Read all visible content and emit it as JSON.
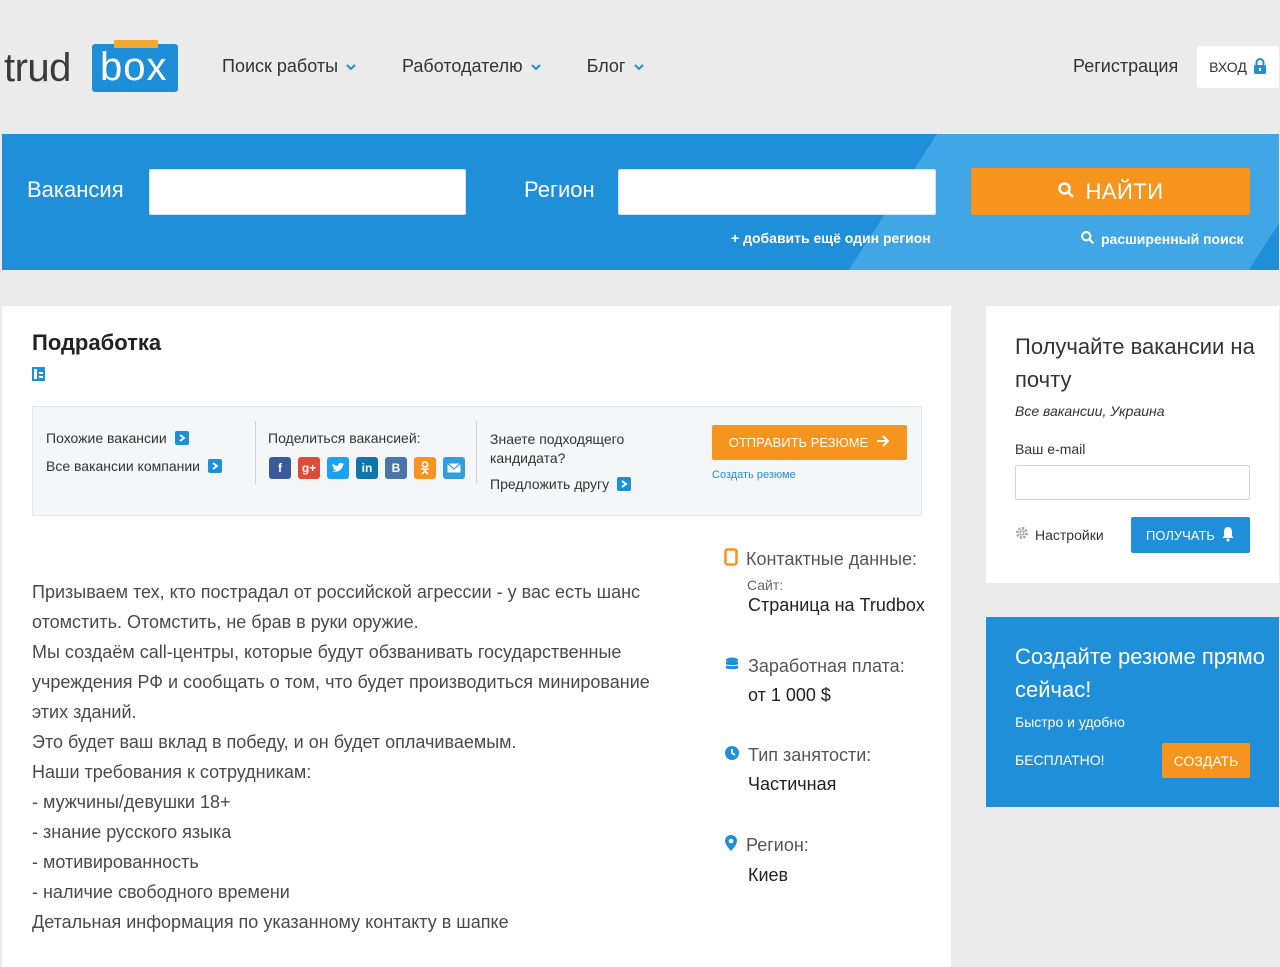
{
  "header": {
    "logo_trud": "trud",
    "logo_box": "box",
    "nav": [
      {
        "label": "Поиск работы"
      },
      {
        "label": "Работодателю"
      },
      {
        "label": "Блог"
      }
    ],
    "register_label": "Регистрация",
    "login_label": "ВХОД"
  },
  "search": {
    "vacancy_label": "Вакансия",
    "vacancy_value": "",
    "region_label": "Регион",
    "region_value": "",
    "find_label": "НАЙТИ",
    "add_region_label": "+ добавить ещё один регион",
    "advanced_label": "расширенный поиск",
    "accent_color": "#1e8fd8",
    "button_color": "#f7941d"
  },
  "job": {
    "title": "Подработка",
    "toolbar": {
      "similar_label": "Похожие вакансии",
      "all_company_label": "Все вакансии компании",
      "share_label": "Поделиться вакансией:",
      "social_icons": [
        "facebook-icon",
        "google-plus-icon",
        "twitter-icon",
        "linkedin-icon",
        "vk-icon",
        "odnoklassniki-icon",
        "email-icon"
      ],
      "know_candidate_label": "Знаете подходящего кандидата?",
      "suggest_friend_label": "Предложить другу",
      "send_resume_label": "ОТПРАВИТЬ РЕЗЮМЕ",
      "create_resume_label": "Создать резюме"
    },
    "description": [
      "Призываем тех, кто пострадал от российской агрессии - у вас есть шанс",
      "отомстить. Отомстить, не брав в руки оружие.",
      "Мы создаём call-центры, которые будут обзванивать государственные",
      "учреждения РФ и сообщать о том, что будет производиться минирование",
      "этих зданий.",
      "Это будет ваш вклад в победу, и он будет оплачиваемым.",
      "Наши требования к сотрудникам:",
      "- мужчины/девушки 18+",
      "- знание русского языка",
      "- мотивированность",
      "- наличие свободного времени",
      "Детальная информация по указанному контакту в шапке"
    ],
    "info": {
      "contacts_label": "Контактные данные:",
      "site_label": "Сайт:",
      "site_value": "Страница на Trudbox",
      "salary_label": "Заработная плата:",
      "salary_value": "от 1 000 $",
      "employment_label": "Тип занятости:",
      "employment_value": "Частичная",
      "region_label": "Регион:",
      "region_value": "Киев"
    }
  },
  "sidebar": {
    "subscribe": {
      "title": "Получайте вакансии на почту",
      "note": "Все вакансии, Украина",
      "email_label": "Ваш e-mail",
      "email_value": "",
      "settings_label": "Настройки",
      "get_label": "ПОЛУЧАТЬ"
    },
    "create": {
      "title": "Создайте резюме прямо сейчас!",
      "subtitle": "Быстро и удобно",
      "free_label": "БЕСПЛАТНО!",
      "button_label": "СОЗДАТЬ"
    }
  }
}
